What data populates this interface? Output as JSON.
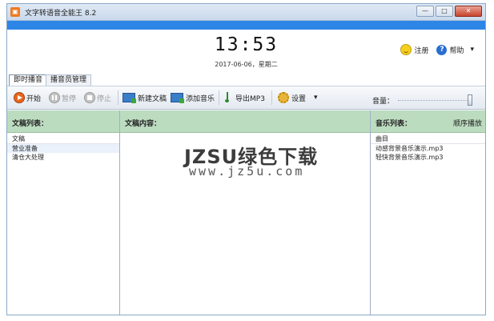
{
  "window": {
    "title": "文字转语音全能王 8.2",
    "icon": "app-logo-icon",
    "controls": [
      "minimize-icon",
      "maximize-icon",
      "close-icon"
    ]
  },
  "header": {
    "clock": "13:53",
    "date": "2017-06-06，星期二",
    "register_label": "注册",
    "help_label": "帮助",
    "help_arrow": "▾"
  },
  "tabs": [
    {
      "label": "即时播音",
      "active": true
    },
    {
      "label": "播音员管理",
      "active": false
    }
  ],
  "toolbar": {
    "start": "开始",
    "pause": "暂停",
    "stop": "停止",
    "new_doc": "新建文稿",
    "add_music": "添加音乐",
    "export": "导出MP3",
    "settings": "设置",
    "settings_arrow": "▾",
    "volume_label": "音量：",
    "volume_level": 1.0
  },
  "panels": {
    "docs": {
      "title": "文稿列表：",
      "column": "文稿",
      "items": [
        "营业准备",
        "清仓大处理"
      ]
    },
    "content": {
      "title": "文稿内容："
    },
    "music": {
      "title": "音乐列表：",
      "mode": "顺序播放",
      "column": "曲目",
      "items": [
        "动感背景音乐演示.mp3",
        "轻快背景音乐演示.mp3"
      ]
    }
  },
  "watermark": {
    "line1": "JZSU绿色下载",
    "line2": "www.jz5u.com"
  },
  "colors": {
    "accent_bar": "#2d86e6",
    "panel_header": "#bcdcc0"
  }
}
